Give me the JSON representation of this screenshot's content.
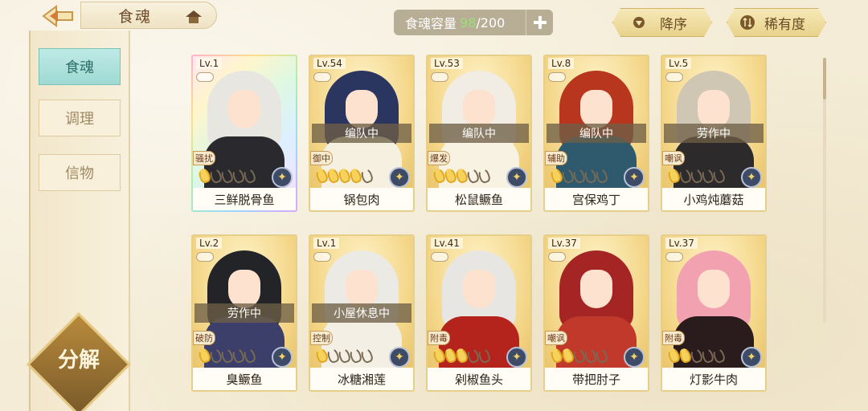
{
  "header": {
    "title": "食魂",
    "capacity": {
      "label": "食魂容量",
      "current": "98",
      "separator": "/",
      "max": "200"
    },
    "sort_desc": "降序",
    "sort_rarity": "稀有度"
  },
  "sidebar": {
    "tabs": [
      {
        "label": "食魂",
        "active": true
      },
      {
        "label": "调理",
        "active": false
      },
      {
        "label": "信物",
        "active": false
      }
    ],
    "decompose": "分解"
  },
  "cards": [
    {
      "level": "Lv.1",
      "name": "三鲜脱骨鱼",
      "status": "",
      "role": "骚扰",
      "stars": 1,
      "rainbow": true,
      "hair": "#e8e6e0",
      "outfit": "#2a2a2e"
    },
    {
      "level": "Lv.54",
      "name": "锅包肉",
      "status": "编队中",
      "role": "御中",
      "stars": 4,
      "rainbow": false,
      "hair": "#2a3560",
      "outfit": "#f6f0e0"
    },
    {
      "level": "Lv.53",
      "name": "松鼠鳜鱼",
      "status": "编队中",
      "role": "爆发",
      "stars": 3,
      "rainbow": false,
      "hair": "#f1ede4",
      "outfit": "#f8f2e2"
    },
    {
      "level": "Lv.8",
      "name": "宫保鸡丁",
      "status": "编队中",
      "role": "辅助",
      "stars": 1,
      "rainbow": false,
      "hair": "#b8361e",
      "outfit": "#2f5a6e"
    },
    {
      "level": "Lv.5",
      "name": "小鸡炖蘑菇",
      "status": "劳作中",
      "role": "嘲讽",
      "stars": 1,
      "rainbow": false,
      "hair": "#cfc6b4",
      "outfit": "#2c2a2a"
    },
    {
      "level": "Lv.2",
      "name": "臭鳜鱼",
      "status": "劳作中",
      "role": "破防",
      "stars": 1,
      "rainbow": false,
      "hair": "#222428",
      "outfit": "#3b3f6a"
    },
    {
      "level": "Lv.1",
      "name": "冰糖湘莲",
      "status": "小屋休息中",
      "role": "控制",
      "stars": 1,
      "rainbow": false,
      "hair": "#eceae4",
      "outfit": "#f3efe4"
    },
    {
      "level": "Lv.41",
      "name": "剁椒鱼头",
      "status": "",
      "role": "附毒",
      "stars": 3,
      "rainbow": false,
      "hair": "#e8e6e2",
      "outfit": "#b5231d"
    },
    {
      "level": "Lv.37",
      "name": "带把肘子",
      "status": "",
      "role": "嘲讽",
      "stars": 2,
      "rainbow": false,
      "hair": "#a52525",
      "outfit": "#c0392b"
    },
    {
      "level": "Lv.37",
      "name": "灯影牛肉",
      "status": "",
      "role": "附毒",
      "stars": 2,
      "rainbow": false,
      "hair": "#f2a1b0",
      "outfit": "#2a1c1c"
    }
  ],
  "colors": {
    "accent": "#e6cf8a",
    "active_tab": "#9fd9d3",
    "capacity_current": "#9be07a"
  }
}
